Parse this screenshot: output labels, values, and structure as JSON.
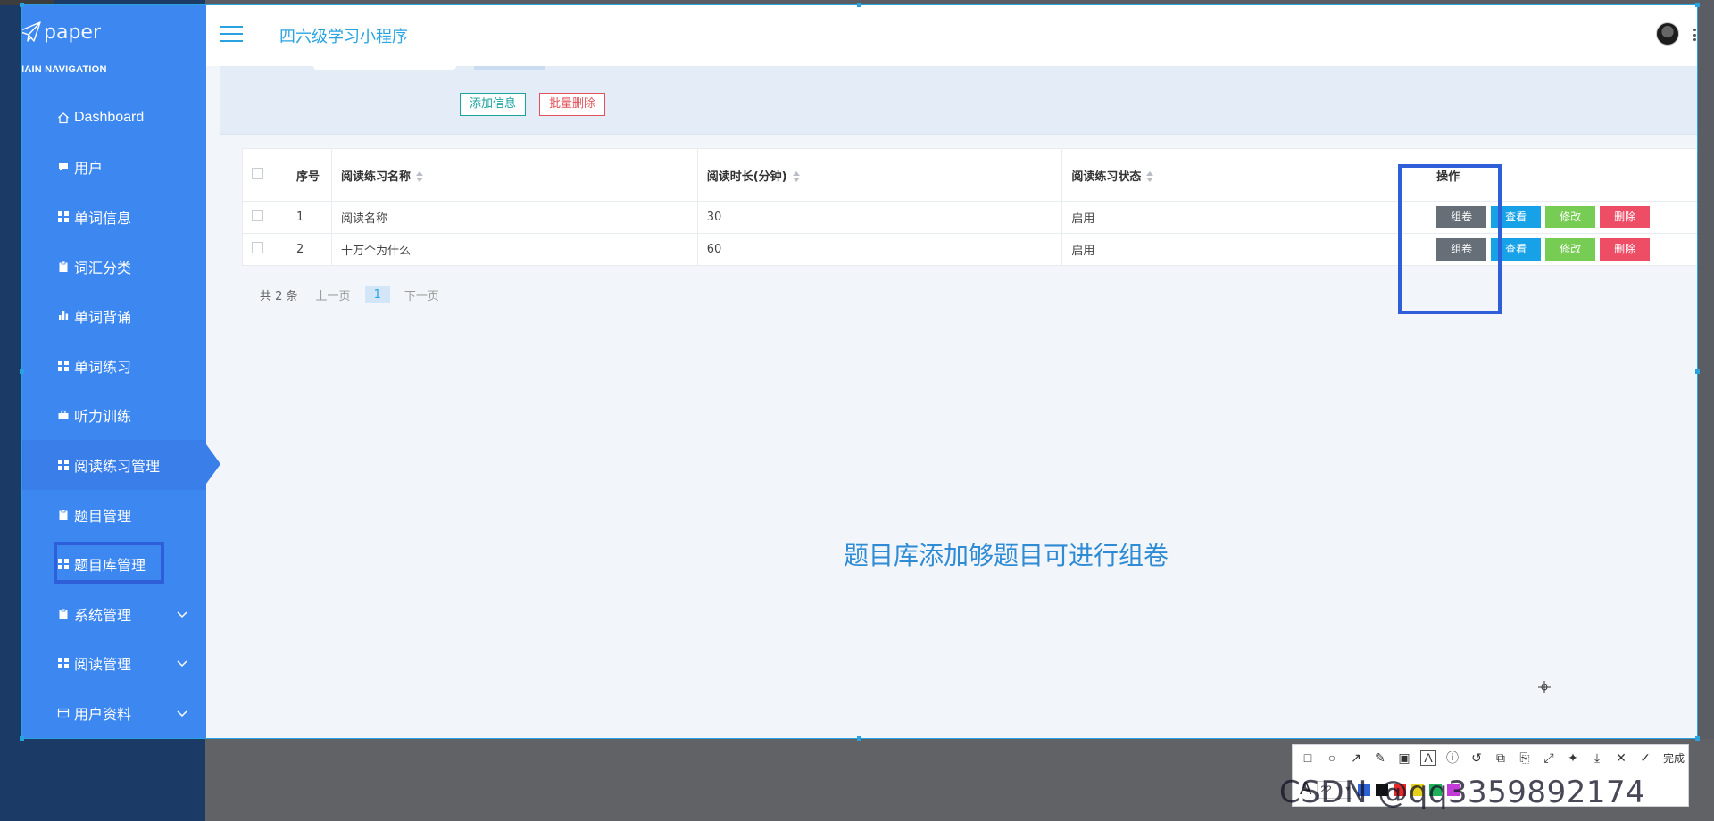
{
  "brand": {
    "name": "paper"
  },
  "nav": {
    "header": "MAIN NAVIGATION",
    "items": [
      {
        "label": "Dashboard",
        "icon": "home-icon"
      },
      {
        "label": "用户",
        "icon": "chat-icon"
      },
      {
        "label": "单词信息",
        "icon": "grid-icon"
      },
      {
        "label": "词汇分类",
        "icon": "clipboard-icon"
      },
      {
        "label": "单词背诵",
        "icon": "bar-chart-icon"
      },
      {
        "label": "单词练习",
        "icon": "grid-icon"
      },
      {
        "label": "听力训练",
        "icon": "briefcase-icon"
      },
      {
        "label": "阅读练习管理",
        "icon": "grid-icon",
        "active": true
      },
      {
        "label": "题目管理",
        "icon": "clipboard-icon"
      },
      {
        "label": "题目库管理",
        "icon": "grid-icon"
      },
      {
        "label": "系统管理",
        "icon": "clipboard-icon",
        "expandable": true
      },
      {
        "label": "阅读管理",
        "icon": "grid-icon",
        "expandable": true
      },
      {
        "label": "用户资料",
        "icon": "card-icon",
        "expandable": true
      }
    ]
  },
  "header": {
    "title": "四六级学习小程序"
  },
  "toolbar": {
    "add_label": "添加信息",
    "batch_delete_label": "批量删除"
  },
  "table": {
    "columns": [
      "序号",
      "阅读练习名称",
      "阅读时长(分钟)",
      "阅读练习状态",
      "操作"
    ],
    "rows": [
      {
        "index": "1",
        "name": "阅读名称",
        "duration": "30",
        "status": "启用"
      },
      {
        "index": "2",
        "name": "十万个为什么",
        "duration": "60",
        "status": "启用"
      }
    ],
    "actions": {
      "assemble": "组卷",
      "view": "查看",
      "edit": "修改",
      "delete": "删除"
    }
  },
  "pager": {
    "total": "共 2 条",
    "prev": "上一页",
    "page": "1",
    "next": "下一页"
  },
  "annotation_text": "题目库添加够题目可进行组卷",
  "snip_tool": {
    "done": "完成",
    "font_size": "22"
  },
  "watermark": "CSDN @qq3359892174",
  "colors": {
    "sidebar": "#3d87f1",
    "accent": "#29a3e0",
    "annotation_box": "#2f5fd8",
    "assemble": "#666f78",
    "view": "#17a2e8",
    "edit": "#77cc54",
    "delete": "#ee4d66"
  }
}
